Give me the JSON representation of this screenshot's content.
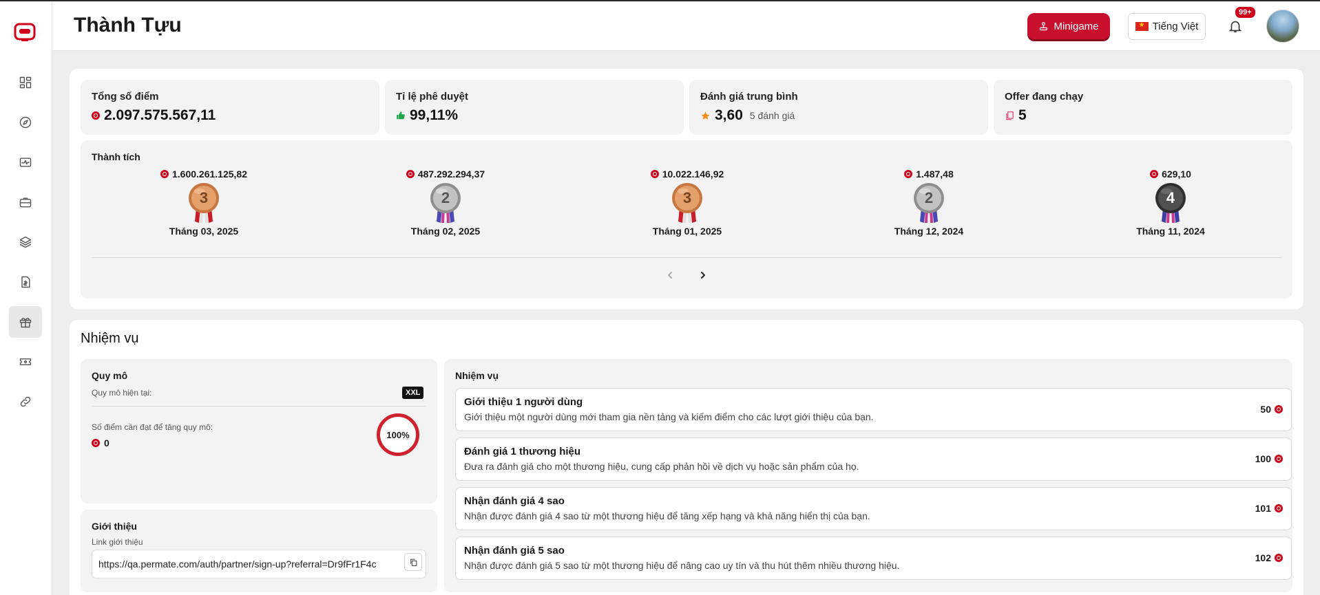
{
  "header": {
    "title": "Thành Tựu",
    "minigame_label": "Minigame",
    "language_label": "Tiếng Việt",
    "notification_count": "99+"
  },
  "stats": [
    {
      "label": "Tổng số điểm",
      "value": "2.097.575.567,11",
      "icon": "coin-icon"
    },
    {
      "label": "Tỉ lệ phê duyệt",
      "value": "99,11%",
      "icon": "thumbs-up-icon"
    },
    {
      "label": "Đánh giá trung bình",
      "value": "3,60",
      "sub": "5 đánh giá",
      "icon": "star-icon"
    },
    {
      "label": "Offer đang chạy",
      "value": "5",
      "icon": "file-stack-icon"
    }
  ],
  "achievements": {
    "title": "Thành tích",
    "items": [
      {
        "points": "1.600.261.125,82",
        "rank": "3",
        "month": "Tháng 03, 2025",
        "tier": "bronze"
      },
      {
        "points": "487.292.294,37",
        "rank": "2",
        "month": "Tháng 02, 2025",
        "tier": "silver"
      },
      {
        "points": "10.022.146,92",
        "rank": "3",
        "month": "Tháng 01, 2025",
        "tier": "bronze"
      },
      {
        "points": "1.487,48",
        "rank": "2",
        "month": "Tháng 12, 2024",
        "tier": "silver"
      },
      {
        "points": "629,10",
        "rank": "4",
        "month": "Tháng 11, 2024",
        "tier": "dark"
      }
    ]
  },
  "missions": {
    "title": "Nhiệm vụ",
    "scale": {
      "title": "Quy mô",
      "current_label": "Quy mô hiện tại:",
      "current_value": "XXL",
      "needed_label": "Số điểm cần đạt để tăng quy mô:",
      "needed_value": "0",
      "progress": "100%"
    },
    "referral": {
      "title": "Giới thiệu",
      "link_label": "Link giới thiệu",
      "link_value": "https://qa.permate.com/auth/partner/sign-up?referral=Dr9fFr1F4c"
    },
    "tasks_title": "Nhiệm vụ",
    "tasks": [
      {
        "title": "Giới thiệu 1 người dùng",
        "desc": "Giới thiệu một người dùng mới tham gia nền tảng và kiếm điểm cho các lượt giới thiệu của bạn.",
        "points": "50"
      },
      {
        "title": "Đánh giá 1 thương hiệu",
        "desc": "Đưa ra đánh giá cho một thương hiệu, cung cấp phản hồi về dịch vụ hoặc sản phẩm của họ.",
        "points": "100"
      },
      {
        "title": "Nhận đánh giá 4 sao",
        "desc": "Nhận được đánh giá 4 sao từ một thương hiệu để tăng xếp hạng và khả năng hiển thị của bạn.",
        "points": "101"
      },
      {
        "title": "Nhận đánh giá 5 sao",
        "desc": "Nhận được đánh giá 5 sao từ một thương hiệu để nâng cao uy tín và thu hút thêm nhiều thương hiệu.",
        "points": "102"
      }
    ]
  },
  "colors": {
    "brand": "#c8102e",
    "bronze": "#d98b52",
    "silver": "#a9a9a9",
    "dark": "#4a4a4a"
  }
}
